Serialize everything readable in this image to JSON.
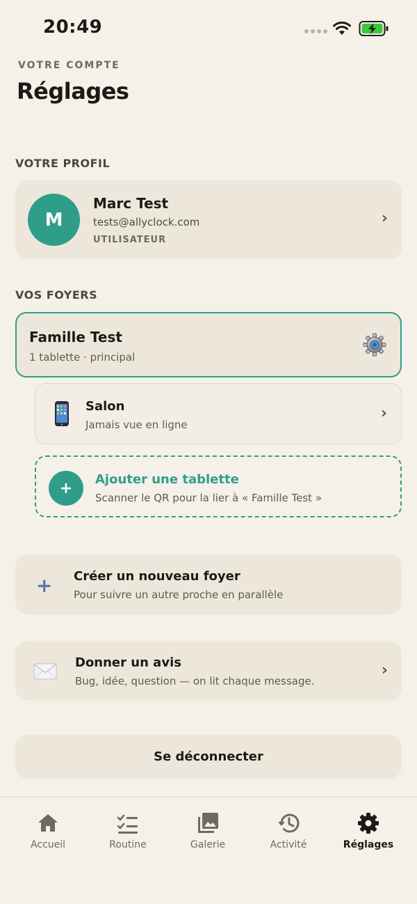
{
  "status_bar": {
    "time": "20:49"
  },
  "header": {
    "eyebrow": "VOTRE COMPTE",
    "title": "Réglages"
  },
  "profile": {
    "section_label": "VOTRE PROFIL",
    "initial": "M",
    "name": "Marc Test",
    "email": "tests@allyclock.com",
    "role": "UTILISATEUR"
  },
  "households": {
    "section_label": "VOS FOYERS",
    "items": [
      {
        "name": "Famille Test",
        "subtitle": "1 tablette · principal",
        "devices": [
          {
            "name": "Salon",
            "status": "Jamais vue en ligne"
          }
        ],
        "add_device": {
          "title": "Ajouter une tablette",
          "subtitle": "Scanner le QR pour la lier à « Famille Test »"
        }
      }
    ]
  },
  "create_household": {
    "title": "Créer un nouveau foyer",
    "subtitle": "Pour suivre un autre proche en parallèle"
  },
  "feedback": {
    "title": "Donner un avis",
    "subtitle": "Bug, idée, question — on lit chaque message."
  },
  "logout_label": "Se déconnecter",
  "chevron": "›",
  "tabs": [
    {
      "label": "Accueil",
      "icon": "home-icon",
      "active": false
    },
    {
      "label": "Routine",
      "icon": "checklist-icon",
      "active": false
    },
    {
      "label": "Galerie",
      "icon": "gallery-icon",
      "active": false
    },
    {
      "label": "Activité",
      "icon": "history-icon",
      "active": false
    },
    {
      "label": "Réglages",
      "icon": "gear-icon",
      "active": true
    }
  ],
  "colors": {
    "accent": "#2f9e89",
    "background": "#f5f0e8",
    "card": "#ede7db",
    "plus": "#5877a3"
  }
}
